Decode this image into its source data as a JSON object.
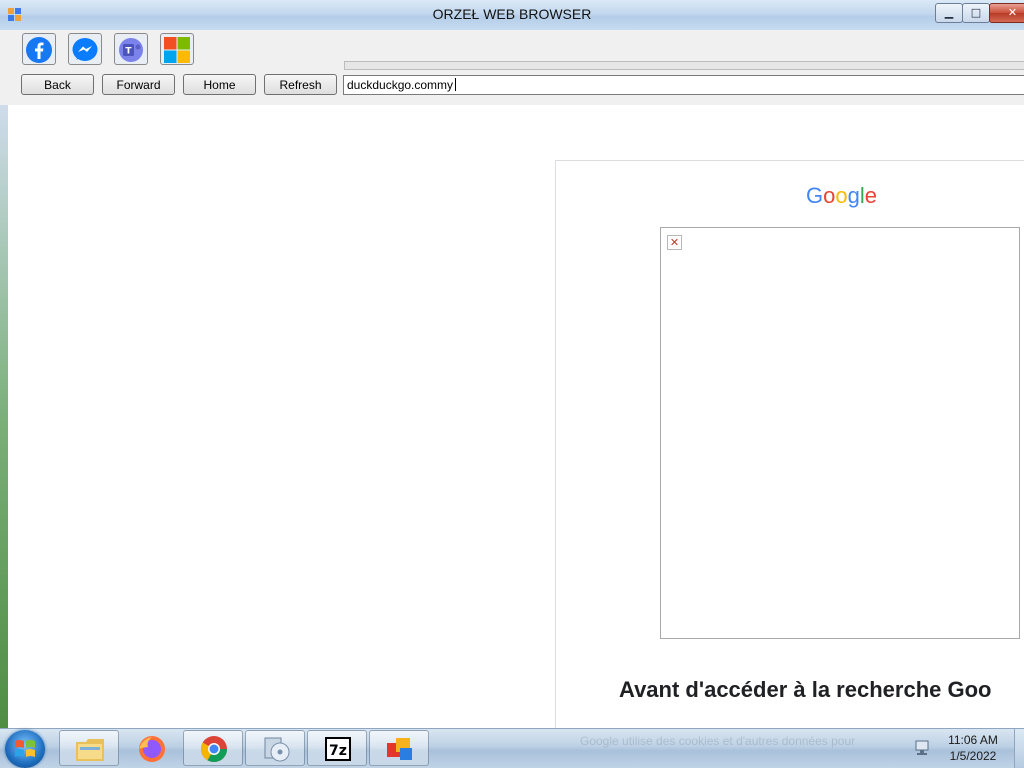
{
  "window": {
    "title": "ORZEŁ WEB BROWSER",
    "min_glyph": "▁",
    "max_glyph": "□",
    "close_glyph": "✕"
  },
  "toolbar": {
    "shortcuts": [
      {
        "name": "facebook-icon",
        "color": "#1877f2"
      },
      {
        "name": "messenger-icon",
        "color": "#0a7cff"
      },
      {
        "name": "teams-icon",
        "color": "#5b5fc7"
      },
      {
        "name": "microsoft-icon",
        "color": "#f25022"
      }
    ],
    "back_label": "Back",
    "forward_label": "Forward",
    "home_label": "Home",
    "refresh_label": "Refresh",
    "address_value": "duckduckgo.commy"
  },
  "page": {
    "logo_letters": [
      "G",
      "o",
      "o",
      "g",
      "l",
      "e"
    ],
    "logo_colors": [
      "#4285f4",
      "#ea4335",
      "#fbbc05",
      "#4285f4",
      "#34a853",
      "#ea4335"
    ],
    "broken_glyph": "✕",
    "heading": "Avant d'accéder à la recherche Goo"
  },
  "taskbar": {
    "items": [
      "file-explorer-icon",
      "firefox-icon",
      "chrome-icon",
      "disc-utility-icon",
      "7zip-icon",
      "orzel-browser-icon"
    ],
    "faded_text": "Google utilise des cookies et d'autres données pour",
    "clock_time": "11:06 AM",
    "clock_date": "1/5/2022"
  }
}
